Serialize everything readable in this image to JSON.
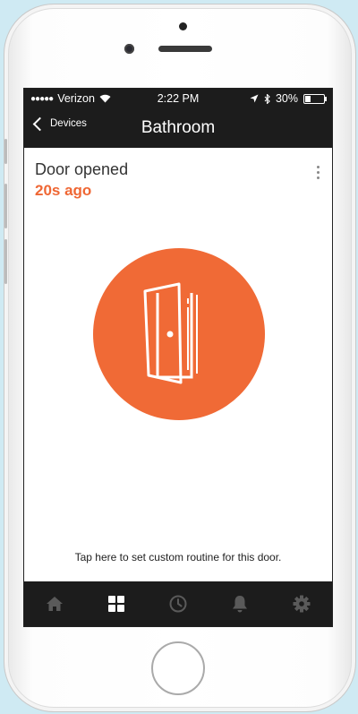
{
  "status_bar": {
    "signal": "●●●●●",
    "carrier": "Verizon",
    "time": "2:22 PM",
    "battery": "30%",
    "battery_level": 0.3
  },
  "nav": {
    "back_label": "Devices",
    "title": "Bathroom"
  },
  "event": {
    "title": "Door opened",
    "time": "20s ago"
  },
  "routine_prompt": "Tap here to set custom routine for this door.",
  "tabs": [
    {
      "icon": "home-icon",
      "active": false
    },
    {
      "icon": "grid-icon",
      "active": true
    },
    {
      "icon": "clock-icon",
      "active": false
    },
    {
      "icon": "bell-icon",
      "active": false
    },
    {
      "icon": "gear-icon",
      "active": false
    }
  ],
  "colors": {
    "accent": "#ef6734",
    "bar": "#1c1c1c",
    "tab_inactive": "#5a5a5a",
    "tab_active": "#ffffff"
  }
}
